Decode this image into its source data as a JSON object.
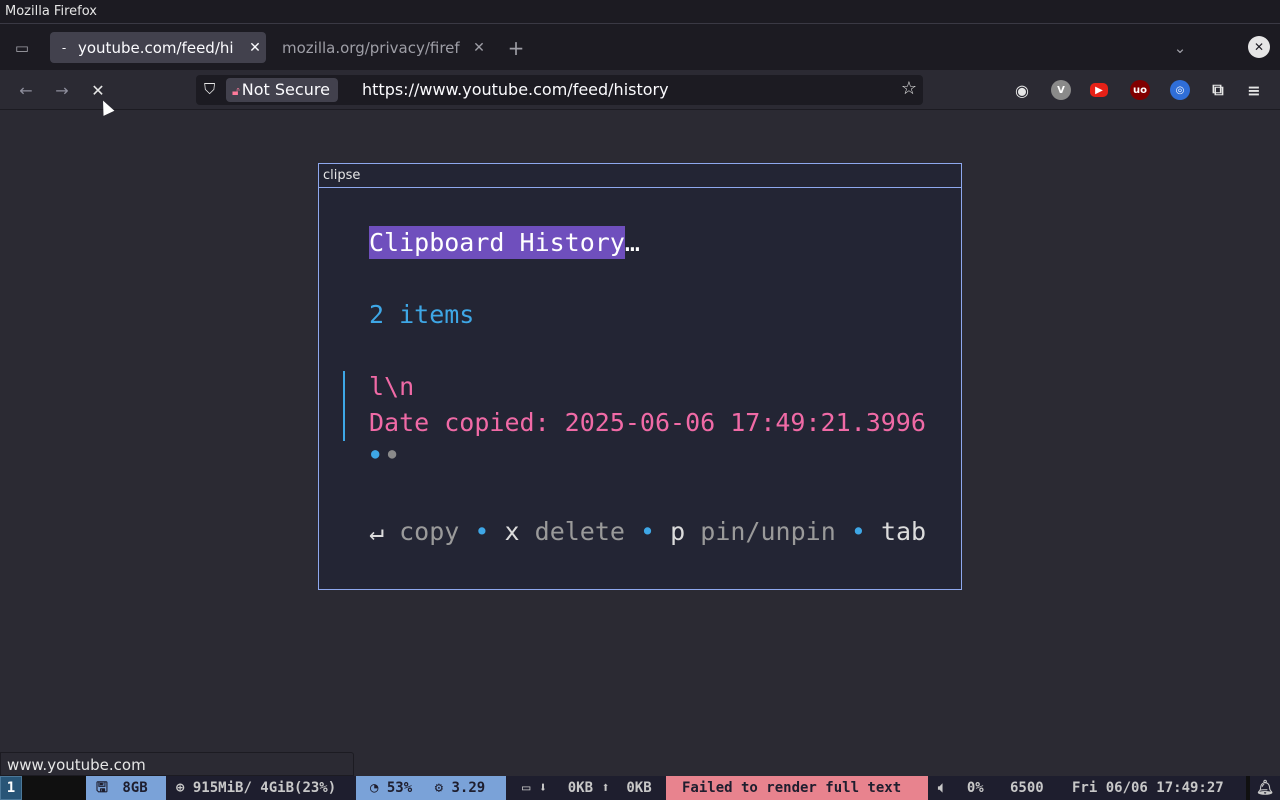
{
  "window": {
    "title": "Mozilla Firefox"
  },
  "tabs": [
    {
      "label": "youtube.com/feed/hi",
      "favicon": "dash-icon",
      "active": true
    },
    {
      "label": "mozilla.org/privacy/firef",
      "active": false
    }
  ],
  "nav": {
    "not_secure": "Not Secure",
    "url": "https://www.youtube.com/feed/history"
  },
  "clipse": {
    "title": "clipse",
    "heading": "Clipboard History",
    "heading_suffix": "…",
    "count": "2 items",
    "item_title": "l\\n",
    "item_date": "Date copied: 2025-06-06 17:49:21.3996",
    "help": {
      "enter_key": "↵",
      "copy": "copy",
      "x_key": "x",
      "delete": "delete",
      "p_key": "p",
      "pin": "pin/unpin",
      "tab_key": "tab",
      "sep": "•"
    }
  },
  "status_url": "www.youtube.com",
  "bar": {
    "workspace": "1",
    "disk": "8GB",
    "mem": "915MiB/ 4GiB(23%)",
    "cpu": "53%",
    "load": "3.29",
    "down": "0KB",
    "up": "0KB",
    "error": "Failed to render full text",
    "volume": "0%",
    "temp": "6500",
    "clock": "Fri 06/06 17:49:27"
  },
  "colors": {
    "accent_purple": "#6f4fbd",
    "pink": "#f06aa6",
    "blue": "#3ea7e6",
    "border": "#8ea8ee"
  }
}
